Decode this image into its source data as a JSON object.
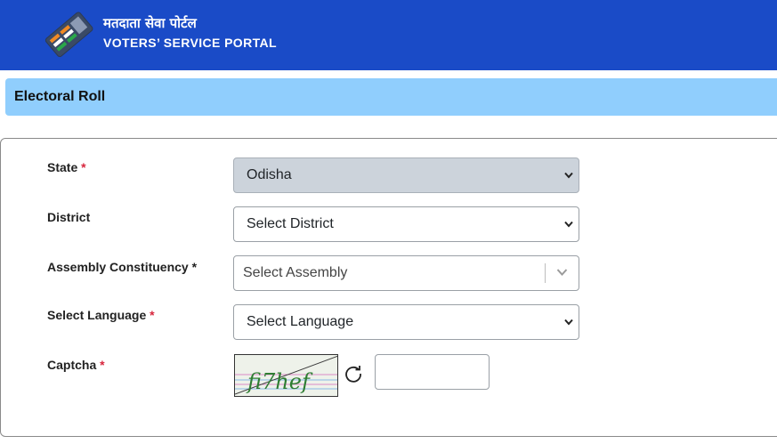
{
  "header": {
    "title_hindi": "मतदाता सेवा पोर्टल",
    "title_english": "VOTERS’ SERVICE PORTAL",
    "logo_icon": "ballot-logo-icon"
  },
  "section": {
    "title": "Electoral Roll"
  },
  "form": {
    "required_mark": "*",
    "state": {
      "label": "State",
      "value": "Odisha",
      "disabled": true
    },
    "district": {
      "label": "District",
      "value": "Select District"
    },
    "assembly": {
      "label": "Assembly Constituency",
      "placeholder": "Select Assembly"
    },
    "language": {
      "label": "Select Language",
      "value": "Select Language"
    },
    "captcha": {
      "label": "Captcha",
      "image_text": "fi7hef",
      "input_value": "",
      "refresh_icon": "refresh-icon"
    }
  },
  "colors": {
    "header_bg": "#1a4bc7",
    "section_bg": "#90cefd",
    "required": "#d7263d",
    "disabled_bg": "#ccd3db"
  }
}
